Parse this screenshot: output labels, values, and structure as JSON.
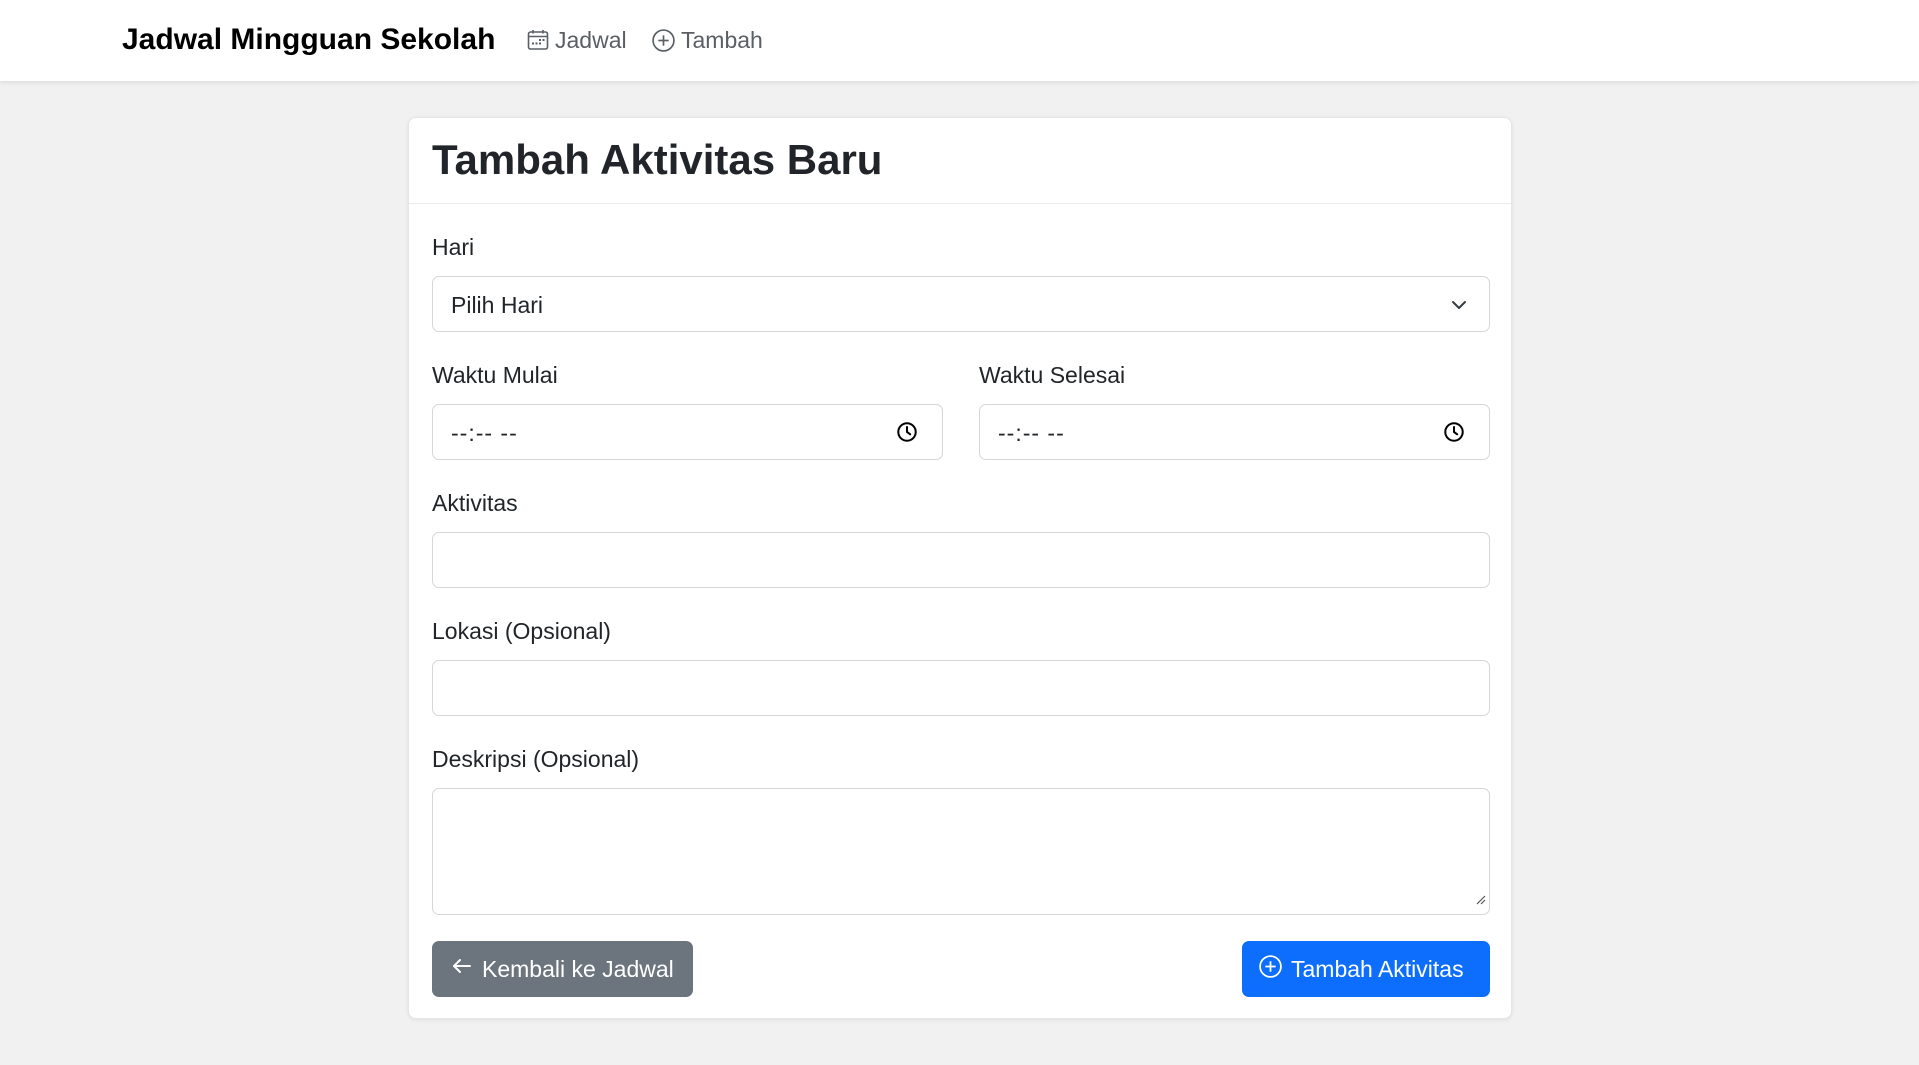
{
  "navbar": {
    "brand": "Jadwal Mingguan Sekolah",
    "links": [
      {
        "label": "Jadwal",
        "icon": "calendar-icon"
      },
      {
        "label": "Tambah",
        "icon": "plus-circle-icon"
      }
    ]
  },
  "form": {
    "title": "Tambah Aktivitas Baru",
    "day": {
      "label": "Hari",
      "value": "Pilih Hari"
    },
    "start_time": {
      "label": "Waktu Mulai",
      "value": "--:-- --"
    },
    "end_time": {
      "label": "Waktu Selesai",
      "value": "--:-- --"
    },
    "activity": {
      "label": "Aktivitas",
      "value": ""
    },
    "location": {
      "label": "Lokasi (Opsional)",
      "value": ""
    },
    "description": {
      "label": "Deskripsi (Opsional)",
      "value": ""
    },
    "back_button": "Kembali ke Jadwal",
    "submit_button": "Tambah Aktivitas"
  },
  "colors": {
    "primary": "#0d6efd",
    "secondary": "#6c757d",
    "background": "#f1f1f1"
  }
}
